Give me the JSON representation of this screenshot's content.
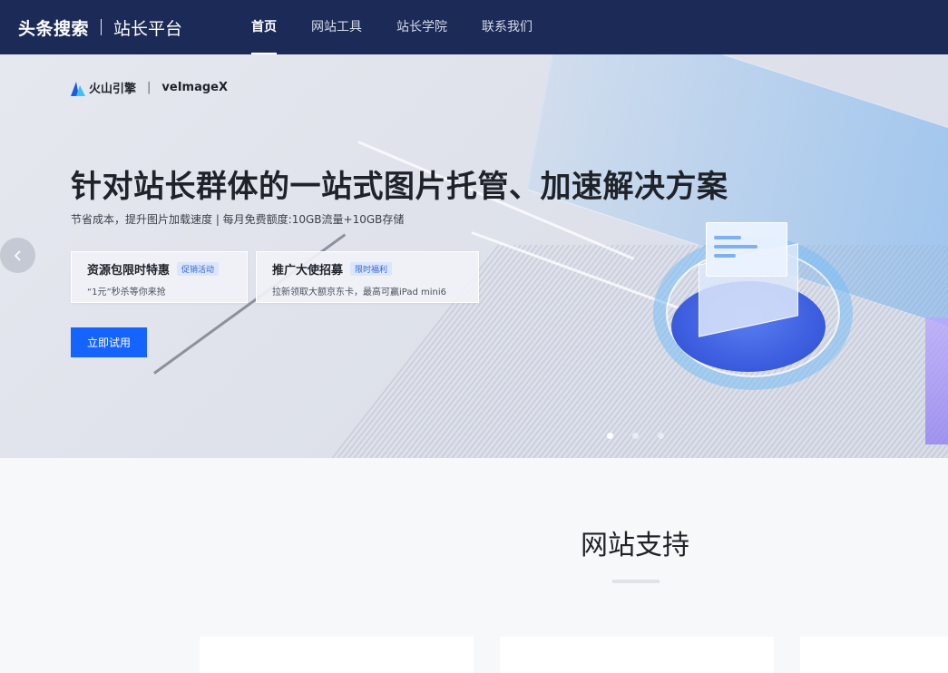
{
  "topnav": {
    "brand_main": "头条搜索",
    "brand_sub": "站长平台",
    "items": [
      {
        "label": "首页",
        "active": true
      },
      {
        "label": "网站工具",
        "active": false
      },
      {
        "label": "站长学院",
        "active": false
      },
      {
        "label": "联系我们",
        "active": false
      }
    ]
  },
  "banner": {
    "partner_name": "火山引擎",
    "partner_sep": "|",
    "partner_product": "veImageX",
    "title": "针对站长群体的一站式图片托管、加速解决方案",
    "subtitle": "节省成本，提升图片加载速度 | 每月免费额度:10GB流量+10GB存储",
    "cards": [
      {
        "title": "资源包限时特惠",
        "tag": "促销活动",
        "desc": "“1元”秒杀等你来抢"
      },
      {
        "title": "推广大使招募",
        "tag": "限时福利",
        "desc": "拉新领取大额京东卡，最高可赢iPad mini6"
      }
    ],
    "cta_label": "立即试用",
    "slide_count": 3,
    "active_slide": 1
  },
  "section": {
    "title": "网站支持"
  },
  "colors": {
    "nav_bg": "#1b2a56",
    "primary": "#1664ff",
    "tag_text": "#3466d6"
  },
  "icons": {
    "prev": "chevron-left-icon",
    "partner_logo": "volcano-engine-logo"
  }
}
